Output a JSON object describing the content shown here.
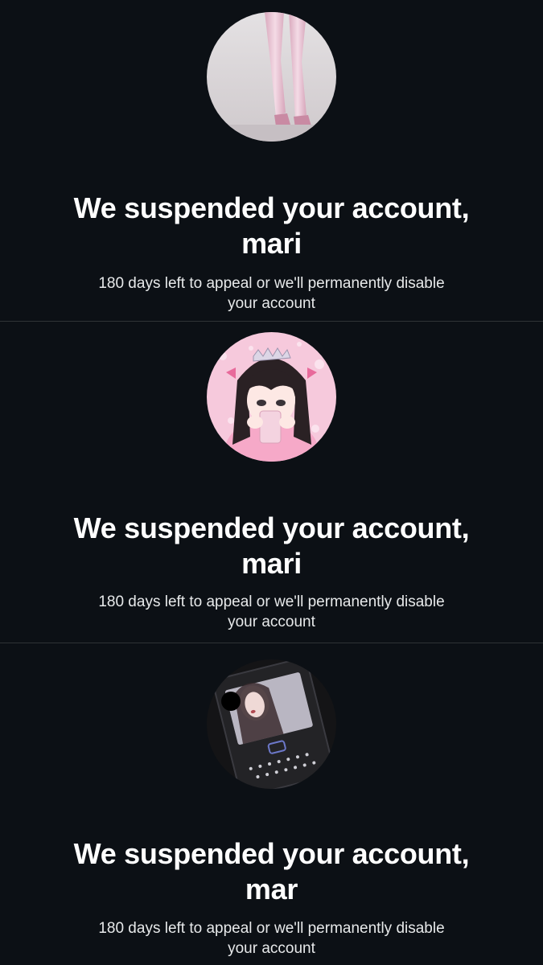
{
  "colors": {
    "background": "#0c1015",
    "heading": "#ffffff",
    "subtext": "#e7e9ea",
    "divider": "#2f3336"
  },
  "notices": [
    {
      "avatar_icon": "legs-stockings-photo",
      "heading_line1": "We suspended your account,",
      "heading_line2": "mari",
      "subtext_line1": "180 days left to appeal or we'll permanently disable",
      "subtext_line2": "your account"
    },
    {
      "avatar_icon": "anime-princess-illustration",
      "heading_line1": "We suspended your account,",
      "heading_line2": "mari",
      "subtext_line1": "180 days left to appeal or we'll permanently disable",
      "subtext_line2": "your account"
    },
    {
      "avatar_icon": "blackberry-phone-photo",
      "heading_line1": "We suspended your account,",
      "heading_line2": "mar",
      "subtext_line1": "180 days left to appeal or we'll permanently disable",
      "subtext_line2": "your account"
    }
  ]
}
